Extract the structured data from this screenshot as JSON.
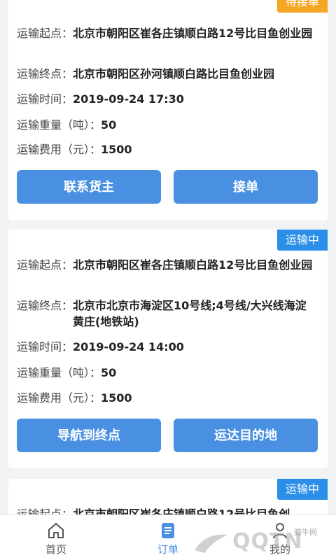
{
  "orders": [
    {
      "status": "待接单",
      "origin_label": "运输起点：",
      "origin": "北京市朝阳区崔各庄镇顺白路12号比目鱼创业园",
      "dest_label": "运输终点：",
      "dest": "北京市朝阳区孙河镇顺白路比目鱼创业园",
      "time_label": "运输时间：",
      "time": "2019-09-24 17:30",
      "weight_label": "运输重量（吨）：",
      "weight": "50",
      "fee_label": "运输费用（元）：",
      "fee": "1500",
      "btn_left": "联系货主",
      "btn_right": "接单"
    },
    {
      "status": "运输中",
      "origin_label": "运输起点：",
      "origin": "北京市朝阳区崔各庄镇顺白路12号比目鱼创业园",
      "dest_label": "运输终点：",
      "dest": "北京市北京市海淀区10号线;4号线/大兴线海淀黄庄(地铁站)",
      "time_label": "运输时间：",
      "time": "2019-09-24 14:00",
      "weight_label": "运输重量（吨）：",
      "weight": "50",
      "fee_label": "运输费用（元）：",
      "fee": "1500",
      "btn_left": "导航到终点",
      "btn_right": "运达目的地"
    },
    {
      "status": "运输中",
      "origin_label": "运输起点：",
      "origin": "北京市朝阳区崔各庄镇顺白路12号比目鱼创"
    }
  ],
  "tabs": [
    {
      "label": "首页",
      "icon": "home-icon"
    },
    {
      "label": "订单",
      "icon": "order-list-icon",
      "active": true
    },
    {
      "label": "我的",
      "icon": "user-icon"
    }
  ],
  "watermark": {
    "text": "QQTN",
    "site": "腾牛网"
  },
  "colors": {
    "primary": "#4a90e2",
    "pending": "#f5a623",
    "transit": "#2b8ee8"
  }
}
